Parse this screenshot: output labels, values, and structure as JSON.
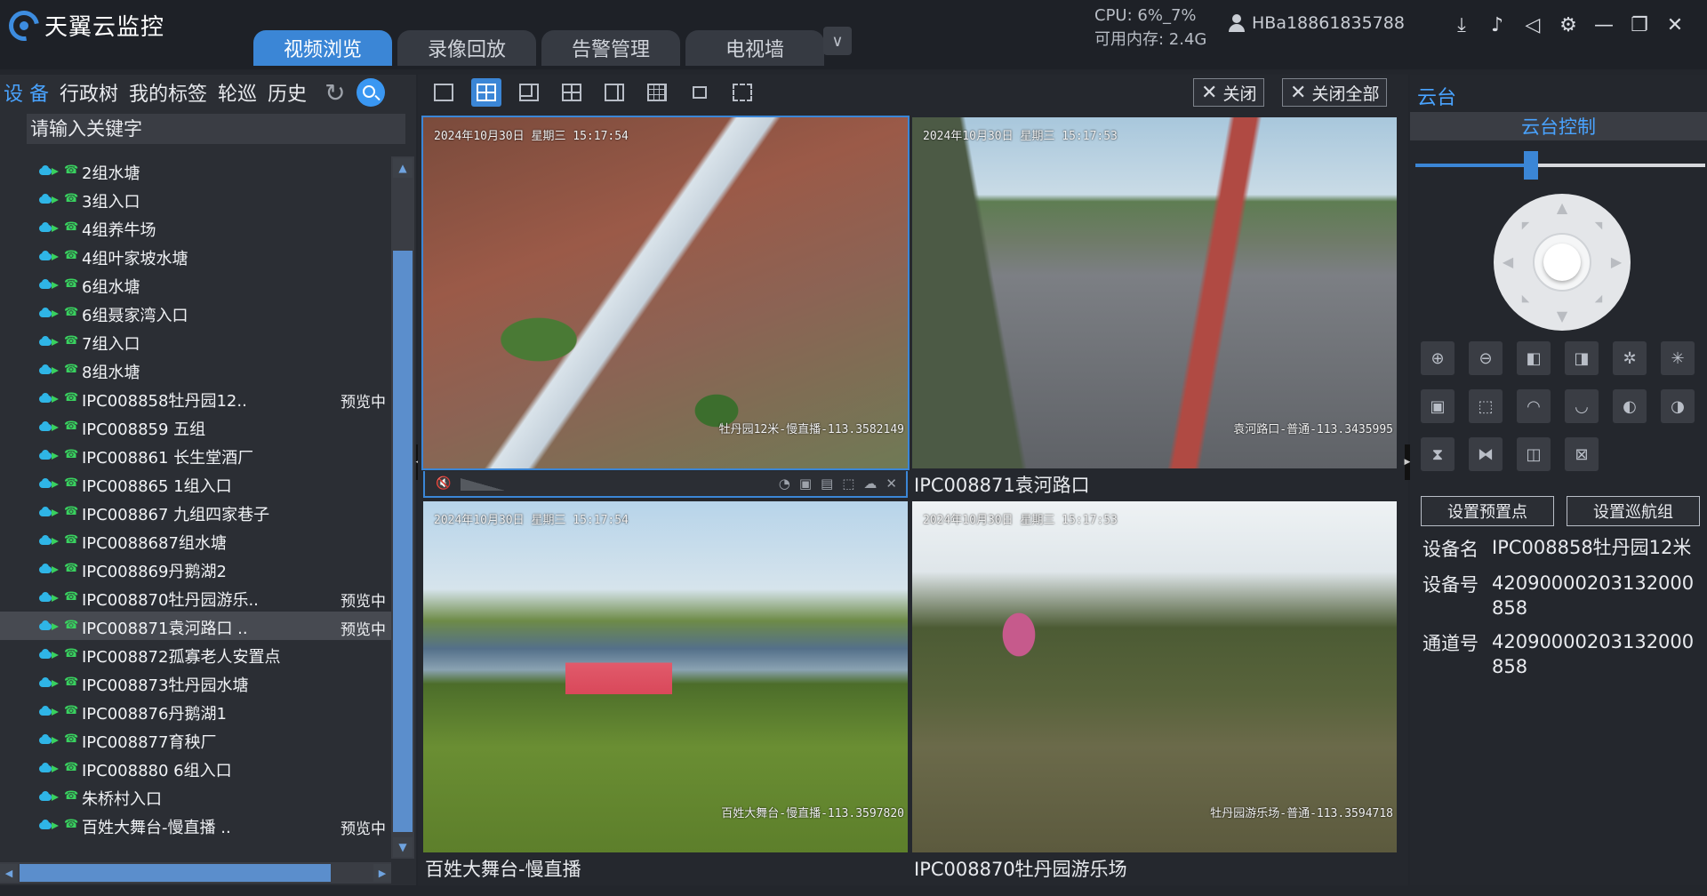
{
  "app": {
    "name": "天翼云监控",
    "tabs": [
      {
        "label": "视频浏览",
        "active": true
      },
      {
        "label": "录像回放",
        "active": false
      },
      {
        "label": "告警管理",
        "active": false
      },
      {
        "label": "电视墙",
        "active": false
      }
    ],
    "cpu": "CPU: 6%_7%",
    "memory": "可用内存: 2.4G",
    "user": "HBa18861835788",
    "window_controls": [
      "download-icon",
      "bell-icon",
      "speaker-icon",
      "gear-icon",
      "minimize-icon",
      "restore-icon",
      "close-icon"
    ]
  },
  "left_panel": {
    "nav": [
      {
        "label": "设 备",
        "active": true
      },
      {
        "label": "行政树",
        "active": false
      },
      {
        "label": "我的标签",
        "active": false
      },
      {
        "label": "轮巡",
        "active": false
      },
      {
        "label": "历史",
        "active": false
      }
    ],
    "search_placeholder": "请输入关键字",
    "devices": [
      {
        "label": "2组水塘",
        "status": ""
      },
      {
        "label": "3组入口",
        "status": ""
      },
      {
        "label": "4组养牛场",
        "status": ""
      },
      {
        "label": "4组叶家坡水塘",
        "status": ""
      },
      {
        "label": "6组水塘",
        "status": ""
      },
      {
        "label": "6组聂家湾入口",
        "status": ""
      },
      {
        "label": "7组入口",
        "status": ""
      },
      {
        "label": "8组水塘",
        "status": ""
      },
      {
        "label": "IPC008858牡丹园12..",
        "status": "预览中"
      },
      {
        "label": "IPC008859 五组",
        "status": ""
      },
      {
        "label": "IPC008861 长生堂酒厂",
        "status": ""
      },
      {
        "label": "IPC008865 1组入口",
        "status": ""
      },
      {
        "label": "IPC008867 九组四家巷子",
        "status": ""
      },
      {
        "label": "IPC0088687组水塘",
        "status": ""
      },
      {
        "label": "IPC008869丹鹅湖2",
        "status": ""
      },
      {
        "label": "IPC008870牡丹园游乐..",
        "status": "预览中"
      },
      {
        "label": "IPC008871袁河路口 ..",
        "status": "预览中",
        "selected": true
      },
      {
        "label": "IPC008872孤寡老人安置点",
        "status": ""
      },
      {
        "label": "IPC008873牡丹园水塘",
        "status": ""
      },
      {
        "label": "IPC008876丹鹅湖1",
        "status": ""
      },
      {
        "label": "IPC008877育秧厂",
        "status": ""
      },
      {
        "label": "IPC008880 6组入口",
        "status": ""
      },
      {
        "label": "朱桥村入口",
        "status": ""
      },
      {
        "label": "百姓大舞台-慢直播    ..",
        "status": "预览中"
      }
    ]
  },
  "center": {
    "layout_buttons": [
      "single-layout-icon",
      "quad-layout-icon",
      "six-layout-icon",
      "eight-layout-icon",
      "wide-layout-icon",
      "nine-layout-icon",
      "pip-layout-icon",
      "fullscreen-icon"
    ],
    "active_layout": 1,
    "close_label": "关闭",
    "close_all_label": "关闭全部",
    "feeds": [
      {
        "timestamp": "2024年10月30日 星期三 15:17:54",
        "osd": "牡丹园12米-慢直播-113.3582149",
        "label": "",
        "selected": true
      },
      {
        "timestamp": "2024年10月30日 星期三 15:17:53",
        "osd": "袁河路口-普通-113.3435995",
        "label": "IPC008871袁河路口",
        "selected": false
      },
      {
        "timestamp": "2024年10月30日 星期三 15:17:54",
        "osd": "百姓大舞台-慢直播-113.3597820",
        "label": "百姓大舞台-慢直播",
        "selected": false
      },
      {
        "timestamp": "2024年10月30日 星期三 15:17:53",
        "osd": "牡丹园游乐场-普通-113.3594718",
        "label": "IPC008870牡丹园游乐场",
        "selected": false
      }
    ]
  },
  "right_panel": {
    "header": "云台",
    "ptz_title": "云台控制",
    "speed_level": 0.4,
    "ptz_buttons": [
      "zoom-in-icon",
      "zoom-out-icon",
      "focus-near-icon",
      "focus-far-icon",
      "iris-open-icon",
      "iris-close-icon",
      "capture-icon",
      "frame-icon",
      "wiper-on-icon",
      "wiper-off-icon",
      "light-on-icon",
      "light-off-icon",
      "flip-vertical-icon",
      "flip-horizontal-icon",
      "mirror-icon",
      "reset-icon"
    ],
    "set_preset_label": "设置预置点",
    "set_cruise_label": "设置巡航组",
    "device_name_key": "设备名",
    "device_name": "IPC008858牡丹园12米",
    "device_id_key": "设备号",
    "device_id": "42090000203132000858",
    "channel_id_key": "通道号",
    "channel_id": "42090000203132000858"
  }
}
